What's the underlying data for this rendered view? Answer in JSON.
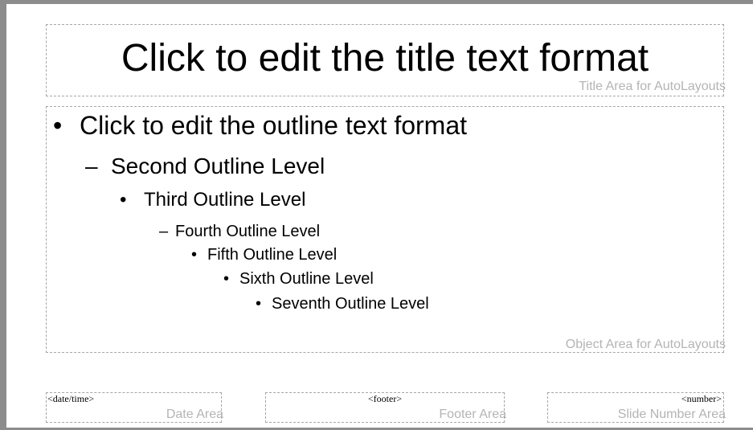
{
  "title_area": {
    "text": "Click to edit the title text format",
    "label": "Title Area for AutoLayouts"
  },
  "object_area": {
    "label": "Object Area for AutoLayouts",
    "outline": [
      {
        "bullet": "•",
        "text": "Click to edit the outline text format"
      },
      {
        "bullet": "–",
        "text": "Second Outline Level"
      },
      {
        "bullet": "•",
        "text": "Third Outline Level"
      },
      {
        "bullet": "–",
        "text": "Fourth Outline Level"
      },
      {
        "bullet": "•",
        "text": "Fifth Outline Level"
      },
      {
        "bullet": "•",
        "text": "Sixth Outline Level"
      },
      {
        "bullet": "•",
        "text": "Seventh Outline Level"
      }
    ]
  },
  "footer_areas": {
    "date": {
      "field": "<date/time>",
      "label": "Date Area"
    },
    "footer": {
      "field": "<footer>",
      "label": "Footer Area"
    },
    "number": {
      "field": "<number>",
      "label": "Slide Number Area"
    }
  }
}
